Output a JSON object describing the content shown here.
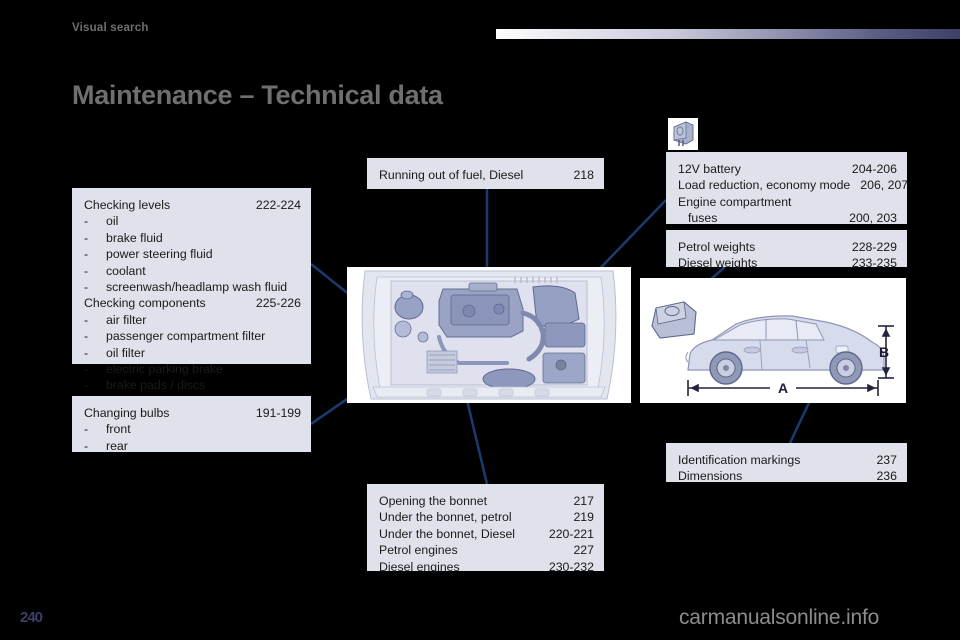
{
  "header": {
    "breadcrumb": "Visual search",
    "title": "Maintenance – Technical data"
  },
  "panels": {
    "checking": {
      "name": "checking-levels-panel",
      "entries": [
        {
          "label": "Checking levels",
          "page": "222-224",
          "type": "heading"
        },
        {
          "label": "oil",
          "type": "bullet"
        },
        {
          "label": "brake fluid",
          "type": "bullet"
        },
        {
          "label": "power steering fluid",
          "type": "bullet"
        },
        {
          "label": "coolant",
          "type": "bullet"
        },
        {
          "label": "screenwash/headlamp wash fluid",
          "type": "bullet"
        },
        {
          "label": "Checking components",
          "page": "225-226",
          "type": "heading"
        },
        {
          "label": "air filter",
          "type": "bullet"
        },
        {
          "label": "passenger compartment filter",
          "type": "bullet"
        },
        {
          "label": "oil filter",
          "type": "bullet"
        },
        {
          "label": "electric parking brake",
          "type": "bullet"
        },
        {
          "label": "brake pads / discs",
          "type": "bullet"
        }
      ]
    },
    "bulbs": {
      "name": "changing-bulbs-panel",
      "entries": [
        {
          "label": "Changing bulbs",
          "page": "191-199",
          "type": "heading"
        },
        {
          "label": "front",
          "type": "bullet"
        },
        {
          "label": "rear",
          "type": "bullet"
        }
      ]
    },
    "fuel": {
      "name": "running-out-of-fuel-panel",
      "entries": [
        {
          "label": "Running out of fuel, Diesel",
          "page": "218",
          "type": "heading"
        }
      ]
    },
    "bonnet": {
      "name": "under-the-bonnet-panel",
      "entries": [
        {
          "label": "Opening the bonnet",
          "page": "217",
          "type": "heading"
        },
        {
          "label": "Under the bonnet, petrol",
          "page": "219",
          "type": "heading"
        },
        {
          "label": "Under the bonnet, Diesel",
          "page": "220-221",
          "type": "heading"
        },
        {
          "label": "Petrol engines",
          "page": "227",
          "type": "heading"
        },
        {
          "label": "Diesel engines",
          "page": "230-232",
          "type": "heading"
        }
      ]
    },
    "battery": {
      "name": "battery-and-fuses-panel",
      "entries": [
        {
          "label": "12V battery",
          "page": "204-206",
          "type": "heading"
        },
        {
          "label": "Load reduction, economy mode",
          "page": "206, 207",
          "type": "heading"
        },
        {
          "label": "Engine compartment",
          "page": "",
          "type": "heading"
        },
        {
          "label": "fuses",
          "page": "200, 203",
          "type": "continuation"
        }
      ]
    },
    "weights": {
      "name": "weights-panel",
      "entries": [
        {
          "label": "Petrol weights",
          "page": "228-229",
          "type": "heading"
        },
        {
          "label": "Diesel weights",
          "page": "233-235",
          "type": "heading"
        }
      ]
    },
    "identification": {
      "name": "identification-panel",
      "entries": [
        {
          "label": "Identification markings",
          "page": "237",
          "type": "heading"
        },
        {
          "label": "Dimensions",
          "page": "236",
          "type": "heading"
        }
      ]
    }
  },
  "bullet_char": "-",
  "figures": {
    "engine": {
      "name": "engine-compartment-illustration",
      "alt": "Engine compartment overhead view"
    },
    "car": {
      "name": "car-side-dimensions-illustration",
      "alt": "Car side view with dimensions A and B"
    },
    "fuse": {
      "name": "fuse-icon",
      "alt": "Blade fuse"
    },
    "dimension_labels": {
      "length": "A",
      "height": "B"
    }
  },
  "footer": {
    "page_number": "240",
    "watermark": "carmanualsonline.info"
  },
  "colors": {
    "page_background": "#000000",
    "panel_background": "#dfe2ea",
    "leader_line": "#1a3a6b",
    "title_text": "#6f6f6f",
    "body_text": "#1a1a1a",
    "accent_blue": "#3c3d68"
  }
}
